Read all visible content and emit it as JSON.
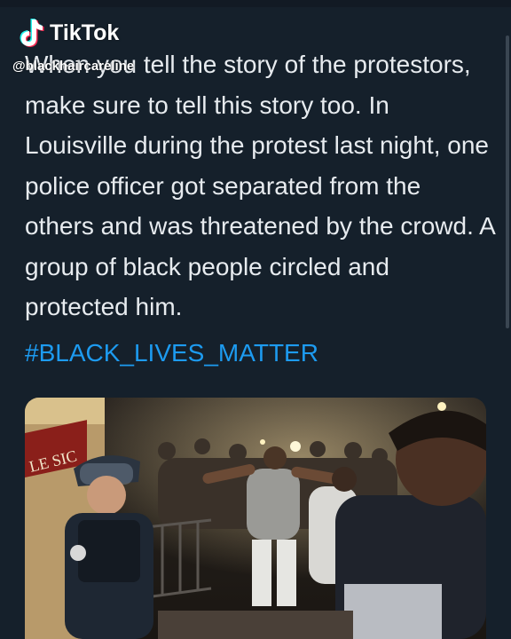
{
  "overlay": {
    "brand": "TikTok",
    "handle": "@blackhaircareline",
    "icon": "tiktok-logo-icon"
  },
  "tweet": {
    "text": "When you tell the story of the protestors, make sure to tell this story too. In Louisville during the protest last night, one police officer got separated from the others and was threatened by the crowd. A group of black people circled and protected him.",
    "hashtag": "#BLACK_LIVES_MATTER",
    "photo_sign_text": "LE SIC",
    "colors": {
      "background": "#15202b",
      "text": "#e7ebef",
      "hashtag": "#1d9bf0"
    }
  }
}
